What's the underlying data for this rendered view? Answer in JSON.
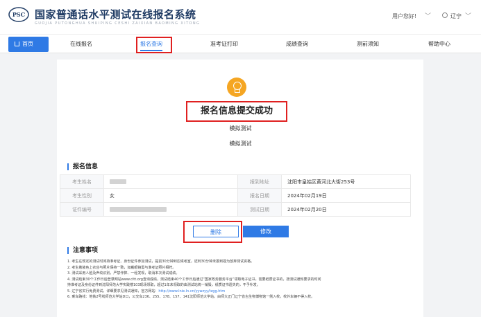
{
  "header": {
    "logo_text": "PSC",
    "title": "国家普通话水平测试在线报名系统",
    "subtitle": "GUOJIA PUTONGHUA SHUIPING CESHI ZAIXIAN BAOMING XITONG",
    "greeting": "用户您好!",
    "location": "辽宁",
    "caret": "﹀"
  },
  "nav": {
    "home": "首页",
    "items": [
      "在线报名",
      "报名查询",
      "准考证打印",
      "成绩查询",
      "测前须知",
      "帮助中心"
    ]
  },
  "result": {
    "title": "报名信息提交成功",
    "test_name_1": "模拟测试",
    "test_name_2": "模拟测试"
  },
  "info": {
    "section_title": "报名信息",
    "rows": [
      {
        "label1": "考生姓名",
        "value1": "",
        "label2": "报到地址",
        "value2": "沈阳市皇姑区黄河北大街253号"
      },
      {
        "label1": "考生性别",
        "value1": "女",
        "label2": "报名日期",
        "value2": "2024年02月19日"
      },
      {
        "label1": "证件编号",
        "value1": "",
        "label2": "测试日期",
        "value2": "2024年02月20日"
      }
    ]
  },
  "buttons": {
    "delete": "删除",
    "edit": "修改"
  },
  "notes": {
    "section_title": "注意事项",
    "items": [
      "1. 考生在规定的测试时间持准考证、身份证件参加测试，提前30分钟到达候考室，迟到30分钟未报到视为放弃测试资格。",
      "2. 考生着装色上衣应与照片保持一致，如戴眼镜需与准考证照片相符。",
      "3. 测试采用人脸及声纹识别，严禁作弊、一经发现，取消本次测试成绩。",
      "4. 测试结束30个工作日后登录网站www.cltt.org查询成绩，测试结束40个工作日后通过“国家政务服务平台”领取电子证书。需要纸质证书的，按测试通知要求的时间",
      "持准考证及身份证件到沈阳师范大学实践楼103现场领取，超过1年未领取的由测试站统一销毁，纸质证书遗失的，不予补发。",
      "5. 辽宁省实行免费测试，详细要求见测试通知，官方网站：",
      "6. 乘车路线：地铁2号线师范大学站D口，公交车236、255、178、157、141沈阳师范大学站，由师大正门辽宁省古生物博物馆一侧入校，校外车辆不得入校。"
    ],
    "link": "http://www.lnie.ln.cn/yywzyy/tzgg.htm"
  }
}
